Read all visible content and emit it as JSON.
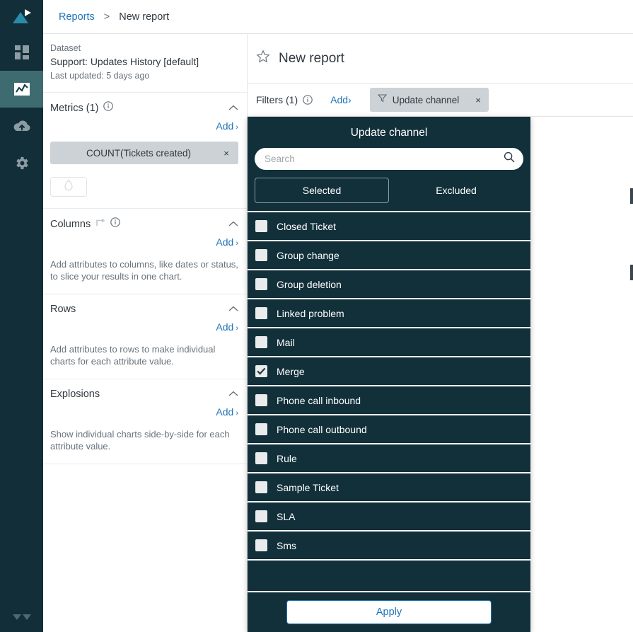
{
  "colors": {
    "rail_bg": "#122e38",
    "rail_active": "#3e6b70",
    "panel_bg": "#12303a",
    "accent_blue": "#1f73b7",
    "chip_gray": "#cdd2d6",
    "logo_teal": "#2a8ba8"
  },
  "rail": {
    "items": [
      {
        "name": "logo",
        "icon": "play-triangle-logo"
      },
      {
        "name": "dashboard",
        "icon": "dashboard-grid-icon",
        "active": false
      },
      {
        "name": "reports",
        "icon": "chart-line-icon",
        "active": true
      },
      {
        "name": "uploads",
        "icon": "cloud-upload-icon",
        "active": false
      },
      {
        "name": "settings",
        "icon": "gear-icon",
        "active": false
      }
    ]
  },
  "breadcrumb": {
    "root": "Reports",
    "separator": ">",
    "current": "New report"
  },
  "dataset": {
    "label": "Dataset",
    "name": "Support: Updates History [default]",
    "updated": "Last updated: 5 days ago"
  },
  "sections": [
    {
      "key": "metrics",
      "title": "Metrics (1)",
      "has_info": true,
      "has_sort": false,
      "add_label": "Add",
      "add_arrow": "›",
      "chip": {
        "label": "COUNT(Tickets created)",
        "remove": "×"
      },
      "drop_button_icon": "water-drop-icon",
      "hint": ""
    },
    {
      "key": "columns",
      "title": "Columns",
      "has_info": true,
      "has_sort": true,
      "add_label": "Add",
      "add_arrow": "›",
      "hint": "Add attributes to columns, like dates or status, to slice your results in one chart."
    },
    {
      "key": "rows",
      "title": "Rows",
      "has_info": false,
      "has_sort": false,
      "add_label": "Add",
      "add_arrow": "›",
      "hint": "Add attributes to rows to make individual charts for each attribute value."
    },
    {
      "key": "explosions",
      "title": "Explosions",
      "has_info": false,
      "has_sort": false,
      "add_label": "Add",
      "add_arrow": "›",
      "hint": "Show individual charts side-by-side for each attribute value."
    }
  ],
  "report": {
    "title": "New report",
    "favorite_icon": "star-outline-icon"
  },
  "filters": {
    "label": "Filters (1)",
    "info_icon": "info-icon",
    "add_label": "Add",
    "add_arrow": "›",
    "chips": [
      {
        "icon": "funnel-icon",
        "label": "Update channel",
        "remove": "×"
      }
    ]
  },
  "panel": {
    "title": "Update channel",
    "search": {
      "placeholder": "Search",
      "value": "",
      "icon": "search-icon"
    },
    "tabs": [
      {
        "label": "Selected",
        "active": true
      },
      {
        "label": "Excluded",
        "active": false
      }
    ],
    "options": [
      {
        "label": "Closed Ticket",
        "checked": false
      },
      {
        "label": "Group change",
        "checked": false
      },
      {
        "label": "Group deletion",
        "checked": false
      },
      {
        "label": "Linked problem",
        "checked": false
      },
      {
        "label": "Mail",
        "checked": false
      },
      {
        "label": "Merge",
        "checked": true
      },
      {
        "label": "Phone call inbound",
        "checked": false
      },
      {
        "label": "Phone call outbound",
        "checked": false
      },
      {
        "label": "Rule",
        "checked": false
      },
      {
        "label": "Sample Ticket",
        "checked": false
      },
      {
        "label": "SLA",
        "checked": false
      },
      {
        "label": "Sms",
        "checked": false
      }
    ],
    "apply_label": "Apply"
  }
}
